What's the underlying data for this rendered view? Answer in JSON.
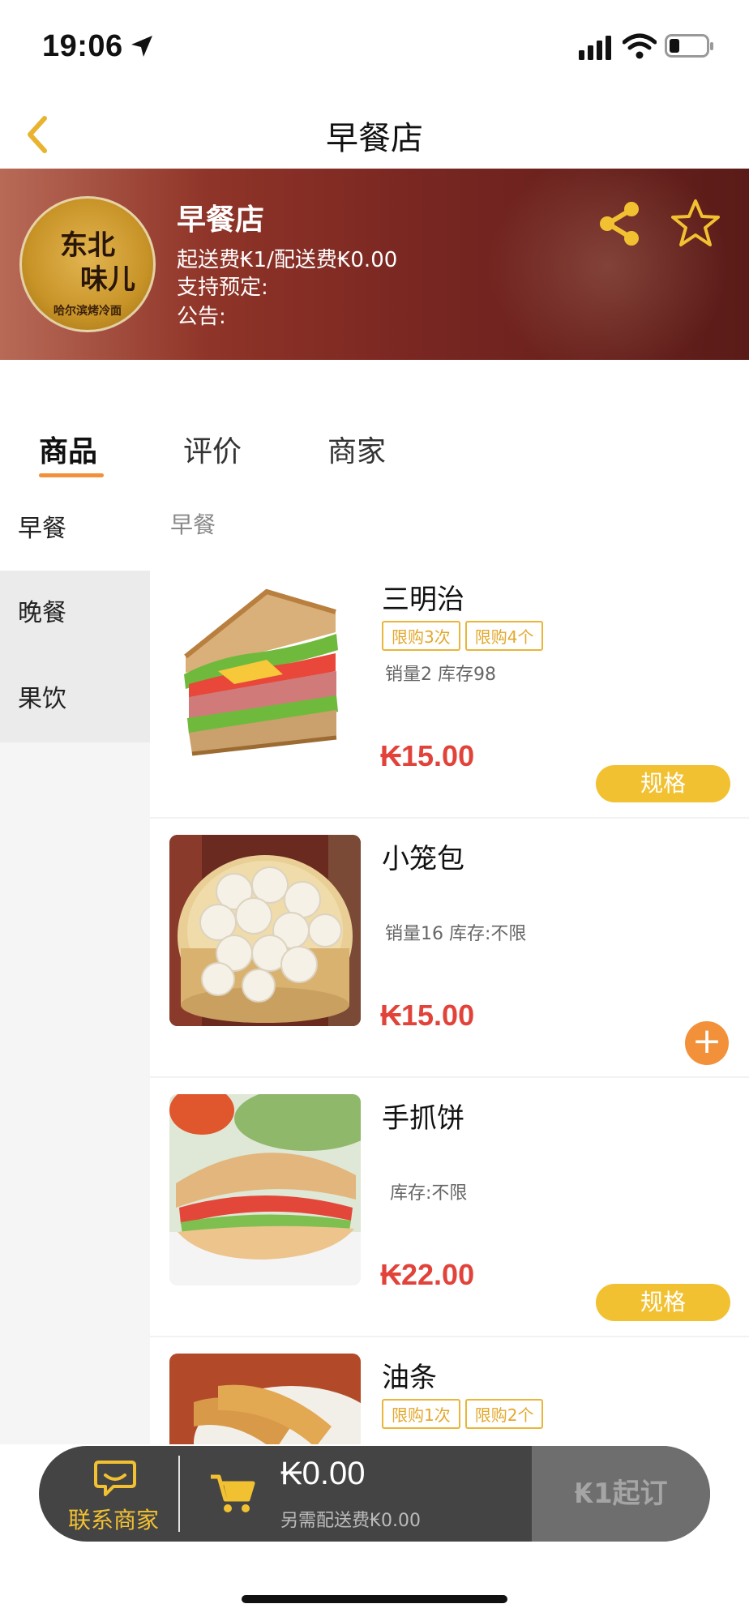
{
  "status_bar": {
    "time": "19:06"
  },
  "nav": {
    "title": "早餐店"
  },
  "shop": {
    "logo_text_top": "东北",
    "logo_text_bottom": "味儿",
    "logo_ring_text": "哈尔滨烤冷面",
    "name": "早餐店",
    "fee_line": "起送费₭1/配送费₭0.00",
    "reserve_line": "支持预定:",
    "notice_line": "公告:"
  },
  "tabs": [
    {
      "label": "商品",
      "active": true
    },
    {
      "label": "评价",
      "active": false
    },
    {
      "label": "商家",
      "active": false
    }
  ],
  "categories": [
    {
      "label": "早餐",
      "active": true
    },
    {
      "label": "晚餐",
      "active": false
    },
    {
      "label": "果饮",
      "active": false
    }
  ],
  "section_title": "早餐",
  "products": [
    {
      "name": "三明治",
      "tags": [
        "限购3次",
        "限购4个"
      ],
      "stats": "销量2 库存98",
      "price": "₭15.00",
      "action": "规格"
    },
    {
      "name": "小笼包",
      "tags": [],
      "stats": "销量16 库存:不限",
      "price": "₭15.00",
      "action": "+"
    },
    {
      "name": "手抓饼",
      "tags": [],
      "stats": "库存:不限",
      "price": "₭22.00",
      "action": "规格"
    },
    {
      "name": "油条",
      "tags": [
        "限购1次",
        "限购2个"
      ],
      "stats": "",
      "price": "",
      "action": ""
    }
  ],
  "cart": {
    "contact_label": "联系商家",
    "total": "₭0.00",
    "delivery_note": "另需配送费₭0.00",
    "checkout_label": "₭1起订"
  },
  "colors": {
    "accent_yellow": "#f2c132",
    "accent_orange": "#f2913a",
    "price_red": "#e1433a",
    "header_brown": "#7a2722"
  }
}
